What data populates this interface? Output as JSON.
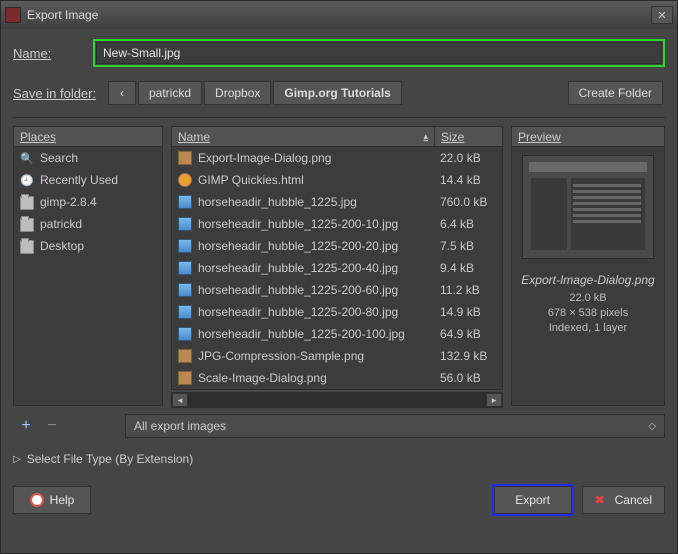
{
  "window": {
    "title": "Export Image"
  },
  "name": {
    "label": "Name:",
    "value": "New-Small.jpg"
  },
  "folder": {
    "label": "Save in folder:",
    "back_icon": "chevron-left-icon",
    "crumbs": [
      "patrickd",
      "Dropbox",
      "Gimp.org Tutorials"
    ],
    "active_index": 2,
    "create_label": "Create Folder"
  },
  "places": {
    "header": "Places",
    "items": [
      {
        "icon": "search-icon",
        "label": "Search"
      },
      {
        "icon": "recent-icon",
        "label": "Recently Used"
      },
      {
        "icon": "folder-icon",
        "label": "gimp-2.8.4"
      },
      {
        "icon": "folder-icon",
        "label": "patrickd"
      },
      {
        "icon": "folder-icon",
        "label": "Desktop"
      }
    ]
  },
  "files": {
    "header_name": "Name",
    "header_size": "Size",
    "rows": [
      {
        "icon": "png",
        "name": "Export-Image-Dialog.png",
        "size": "22.0 kB"
      },
      {
        "icon": "html",
        "name": "GIMP Quickies.html",
        "size": "14.4 kB"
      },
      {
        "icon": "jpg",
        "name": "horseheadir_hubble_1225.jpg",
        "size": "760.0 kB"
      },
      {
        "icon": "jpg",
        "name": "horseheadir_hubble_1225-200-10.jpg",
        "size": "6.4 kB"
      },
      {
        "icon": "jpg",
        "name": "horseheadir_hubble_1225-200-20.jpg",
        "size": "7.5 kB"
      },
      {
        "icon": "jpg",
        "name": "horseheadir_hubble_1225-200-40.jpg",
        "size": "9.4 kB"
      },
      {
        "icon": "jpg",
        "name": "horseheadir_hubble_1225-200-60.jpg",
        "size": "11.2 kB"
      },
      {
        "icon": "jpg",
        "name": "horseheadir_hubble_1225-200-80.jpg",
        "size": "14.9 kB"
      },
      {
        "icon": "jpg",
        "name": "horseheadir_hubble_1225-200-100.jpg",
        "size": "64.9 kB"
      },
      {
        "icon": "png",
        "name": "JPG-Compression-Sample.png",
        "size": "132.9 kB"
      },
      {
        "icon": "png",
        "name": "Scale-Image-Dialog.png",
        "size": "56.0 kB"
      }
    ]
  },
  "preview": {
    "header": "Preview",
    "name": "Export-Image-Dialog.png",
    "size": "22.0 kB",
    "dims": "678 × 538 pixels",
    "mode": "Indexed, 1 layer"
  },
  "filter": {
    "label": "All export images"
  },
  "filetype": {
    "label": "Select File Type (By Extension)"
  },
  "buttons": {
    "help": "Help",
    "export": "Export",
    "cancel": "Cancel"
  }
}
